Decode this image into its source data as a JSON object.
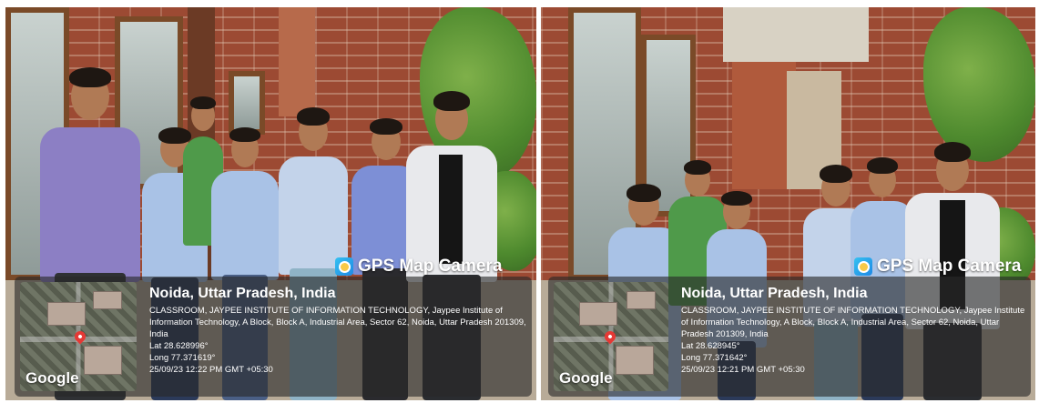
{
  "photos": [
    {
      "watermark_label": "GPS Map Camera",
      "map_logo": "Google",
      "location_title": "Noida, Uttar Pradesh, India",
      "address": "CLASSROOM, JAYPEE INSTITUTE OF INFORMATION TECHNOLOGY, Jaypee Institute of Information Technology, A Block, Block A, Industrial Area, Sector 62, Noida, Uttar Pradesh 201309, India",
      "lat": "Lat 28.628996°",
      "long": "Long 77.371619°",
      "timestamp": "25/09/23 12:22 PM GMT +05:30"
    },
    {
      "watermark_label": "GPS Map Camera",
      "map_logo": "Google",
      "location_title": "Noida, Uttar Pradesh, India",
      "address": "CLASSROOM, JAYPEE INSTITUTE OF INFORMATION TECHNOLOGY, Jaypee Institute of Information Technology, A Block, Block A, Industrial Area, Sector 62, Noida, Uttar Pradesh 201309, India",
      "lat": "Lat 28.628945°",
      "long": "Long 77.371642°",
      "timestamp": "25/09/23 12:21 PM GMT +05:30"
    }
  ],
  "colors": {
    "brick": "#9c4a33",
    "shirt_blue": "#a9c2e6",
    "shirt_purple": "#8c7fc4",
    "shirt_green": "#4f9a4a",
    "shirt_white": "#e8e9ec",
    "card_bg": "rgba(40,40,40,0.62)"
  },
  "icons": [
    "gps-map-camera-icon",
    "map-pin-icon"
  ]
}
